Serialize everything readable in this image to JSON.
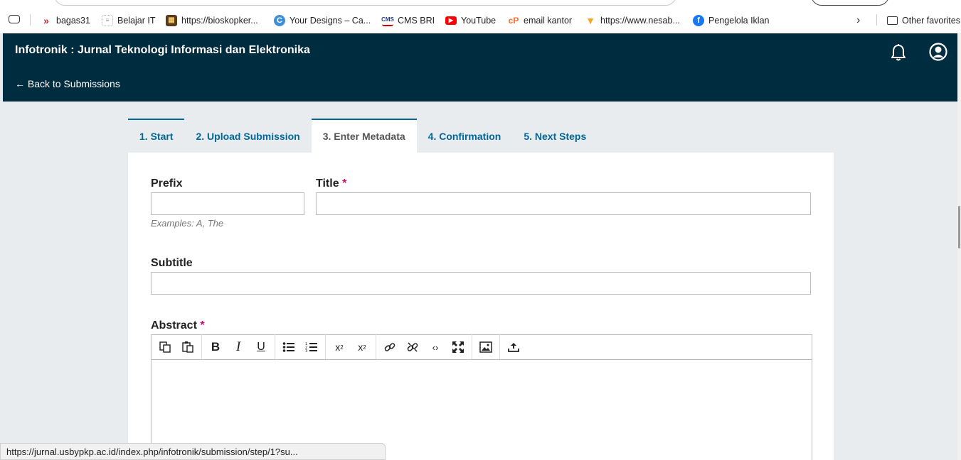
{
  "browser": {
    "bookmarks": [
      {
        "label": "bagas31",
        "icon": "bagas31-icon",
        "color": "#c0282d"
      },
      {
        "label": "Belajar IT",
        "icon": "cms-small-icon",
        "color": "#888888"
      },
      {
        "label": "https://bioskopker...",
        "icon": "film-icon",
        "color": "#5b3a1a"
      },
      {
        "label": "Your Designs – Ca...",
        "icon": "canva-icon",
        "color": "#3f8fd8"
      },
      {
        "label": "CMS BRI",
        "icon": "cms-bri-icon",
        "color": "#1c3d8f"
      },
      {
        "label": "YouTube",
        "icon": "youtube-icon",
        "color": "#ff0000"
      },
      {
        "label": "email kantor",
        "icon": "cpanel-icon",
        "color": "#ff6c2c"
      },
      {
        "label": "https://www.nesab...",
        "icon": "fox-icon",
        "color": "#f5a623"
      },
      {
        "label": "Pengelola Iklan",
        "icon": "facebook-icon",
        "color": "#1877f2"
      }
    ],
    "other_favorites": "Other favorites",
    "status_url": "https://jurnal.usbypkp.ac.id/index.php/infotronik/submission/step/1?su..."
  },
  "header": {
    "journal_title": "Infotronik : Jurnal Teknologi Informasi dan Elektronika",
    "back_link": "← Back to Submissions"
  },
  "tabs": [
    {
      "label": "1. Start"
    },
    {
      "label": "2. Upload Submission"
    },
    {
      "label": "3. Enter Metadata"
    },
    {
      "label": "4. Confirmation"
    },
    {
      "label": "5. Next Steps"
    }
  ],
  "form": {
    "prefix_label": "Prefix",
    "prefix_value": "",
    "prefix_help": "Examples: A, The",
    "title_label": "Title",
    "title_value": "",
    "required_mark": "*",
    "subtitle_label": "Subtitle",
    "subtitle_value": "",
    "abstract_label": "Abstract"
  },
  "toolbar": {
    "groups": [
      [
        "copy-icon",
        "paste-icon"
      ],
      [
        "bold-icon",
        "italic-icon",
        "underline-icon"
      ],
      [
        "bullet-list-icon",
        "numbered-list-icon"
      ],
      [
        "superscript-icon",
        "subscript-icon"
      ],
      [
        "link-icon",
        "unlink-icon",
        "code-icon",
        "fullscreen-icon"
      ],
      [
        "image-icon"
      ],
      [
        "upload-icon"
      ]
    ]
  }
}
